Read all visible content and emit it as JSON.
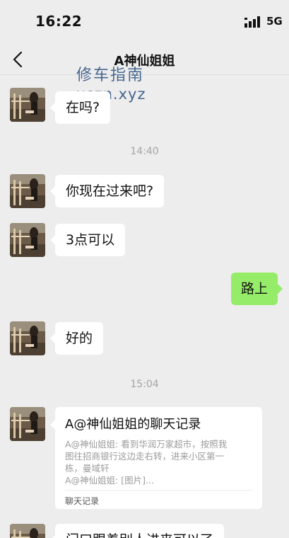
{
  "status_bar": {
    "time": "16:22",
    "network": "5G"
  },
  "nav": {
    "title": "A神仙姐姐"
  },
  "watermark": {
    "line1": "修车指南",
    "line2": "xczn.xyz"
  },
  "messages": [
    {
      "side": "left",
      "text": "在吗?"
    },
    {
      "type": "time",
      "text": "14:40"
    },
    {
      "side": "left",
      "text": "你现在过来吧?"
    },
    {
      "side": "left",
      "text": "3点可以"
    },
    {
      "side": "right",
      "text": "路上"
    },
    {
      "side": "left",
      "text": "好的"
    },
    {
      "type": "time",
      "text": "15:04"
    },
    {
      "side": "left",
      "type": "chat-record",
      "title": "A@神仙姐姐的聊天记录",
      "lines": [
        "A@神仙姐姐: 看到华润万家超市，按照我",
        "图往招商银行这边走右转，进来小区第一",
        "栋，曼域轩",
        "A@神仙姐姐: [图片]..."
      ],
      "footer": "聊天记录"
    },
    {
      "side": "left",
      "text": "门口跟着别人进来可以了"
    }
  ]
}
